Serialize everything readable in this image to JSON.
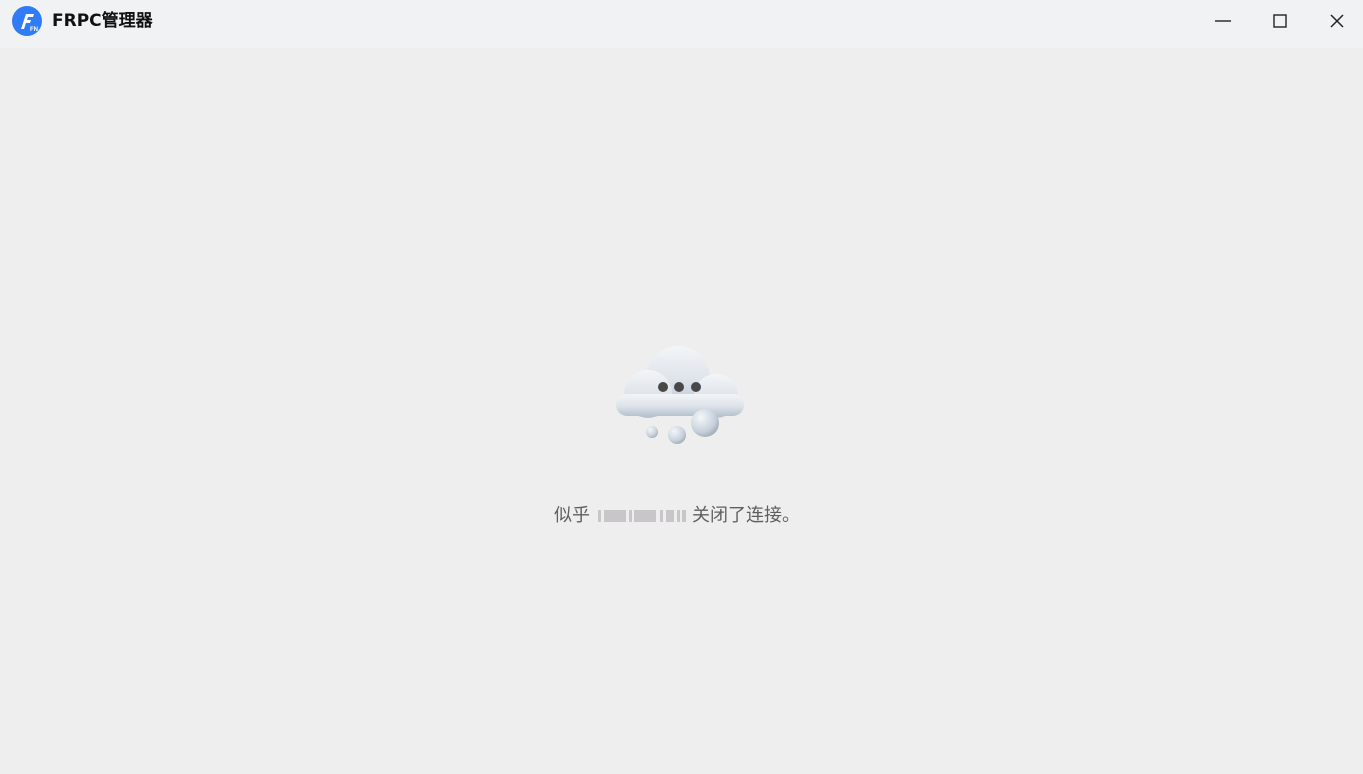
{
  "window": {
    "title": "FRPC管理器",
    "logo_icon": "frpc-app-logo-icon",
    "controls": {
      "minimize_icon": "minimize-icon",
      "maximize_icon": "maximize-icon",
      "close_icon": "close-icon"
    }
  },
  "main": {
    "illustration_icon": "cloud-disconnected-icon",
    "message_prefix": "似乎",
    "message_suffix": "关闭了连接。"
  },
  "colors": {
    "background": "#eeeeee",
    "titlebar": "#f1f2f4",
    "logo_blue": "#2f7cf6",
    "text": "#5f5f5f"
  }
}
